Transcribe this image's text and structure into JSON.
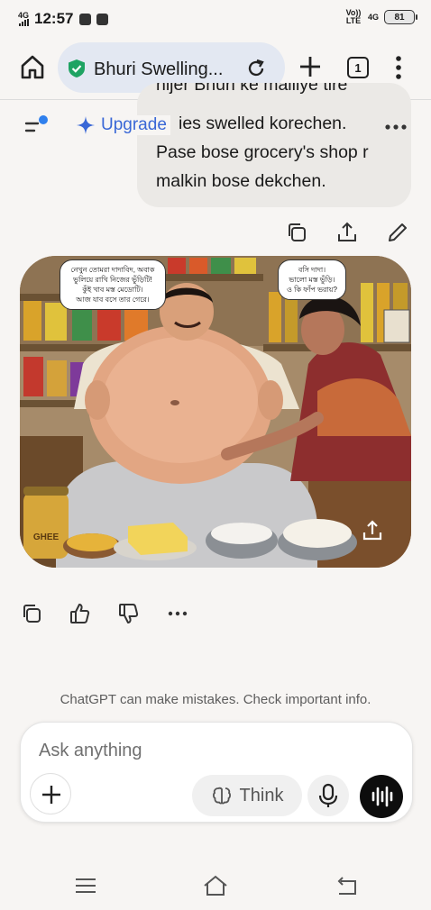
{
  "status_bar": {
    "network_label": "4G",
    "time": "12:57",
    "volte_label": "Vo)) LTE",
    "net_type": "4G",
    "battery": "81"
  },
  "browser": {
    "tab_title": "Bhuri Swelling...",
    "tab_count": "1"
  },
  "chat": {
    "upgrade_label": "Upgrade",
    "user_message_lines": [
      "hijer Bhuri ke malliye tire",
      "ies swelled korechen.",
      "Pase bose grocery's shop r",
      "malkin bose dekchen."
    ],
    "speech_left": [
      "নেখুন তোমরা দাদাবিদ, অবাক",
      "ভুলিয়ে রাখি নিজের ভুঁড়িটি!",
      "কুঁই খাব মস্ত মেডোটি।",
      "আজ যাব বসে তার গেরে।"
    ],
    "speech_right": [
      "বসি দাদা।",
      "ভালো মস্ত ভুঁড়ি।",
      "ও কি ফাঁপ ভরায়?"
    ],
    "jar_label": "GHEE"
  },
  "composer": {
    "placeholder": "Ask anything",
    "think_label": "Think"
  },
  "disclaimer": "ChatGPT can make mistakes. Check important info.",
  "colors": {
    "accent_blue": "#3967d6",
    "shield_green": "#1ea362",
    "dot_blue": "#2f80ed",
    "page_bg": "#f7f5f3"
  }
}
